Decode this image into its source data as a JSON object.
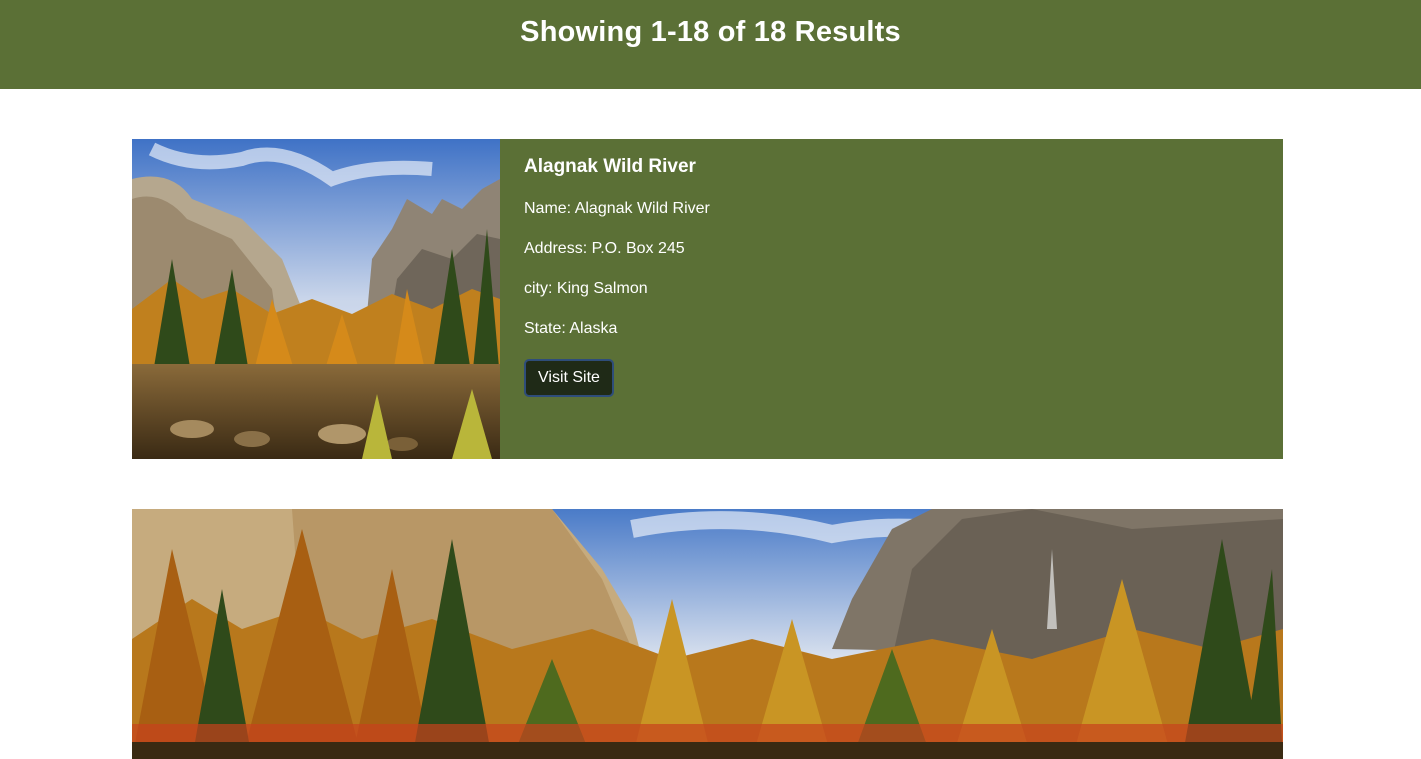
{
  "header": {
    "results_text": "Showing 1-18 of 18 Results"
  },
  "results": [
    {
      "title": "Alagnak Wild River",
      "name_line": "Name: Alagnak Wild River",
      "address_line": "Address: P.O. Box 245",
      "city_line": "city: King Salmon",
      "state_line": "State: Alaska",
      "button_label": "Visit Site",
      "image_description": "landscape-photo"
    }
  ],
  "colors": {
    "header_bg": "#5b7036",
    "card_bg": "#5b7036",
    "button_bg": "#1f2a17",
    "button_border": "#2e4d7a"
  }
}
